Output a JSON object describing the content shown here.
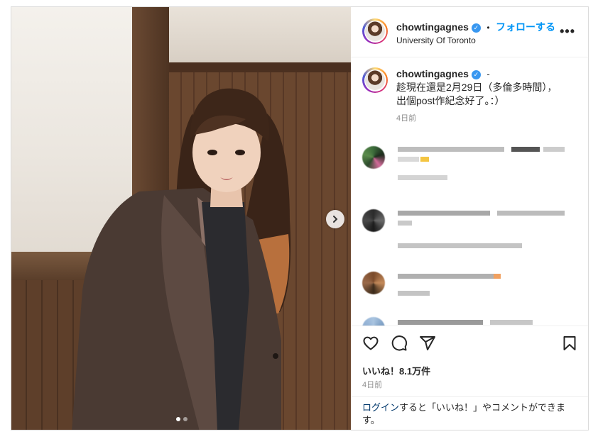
{
  "post": {
    "username": "chowtingagnes",
    "follow_label": "フォローする",
    "separator": "•",
    "location": "University Of Toronto",
    "more_label": "•••",
    "verified_mark": "✓"
  },
  "caption": {
    "username": "chowtingagnes",
    "suffix": "-",
    "line1": "趁現在還是2月29日（多倫多時間），",
    "line2": "出個post作紀念好了。：）",
    "time": "4日前"
  },
  "engagement": {
    "likes": "いいね！8.1万件",
    "time": "4日前"
  },
  "login_prompt": {
    "link": "ログイン",
    "text": "すると「いいね！」やコメントができます。"
  },
  "carousel": {
    "slide_count": 2,
    "active_index": 0
  },
  "icons": [
    "heart-icon",
    "comment-icon",
    "share-icon",
    "bookmark-icon",
    "chevron-right-icon",
    "more-icon",
    "verified-icon"
  ],
  "colors": {
    "accent": "#0095f6",
    "link_dark": "#00376b",
    "verified": "#3897f0",
    "muted": "#8e8e8e"
  }
}
